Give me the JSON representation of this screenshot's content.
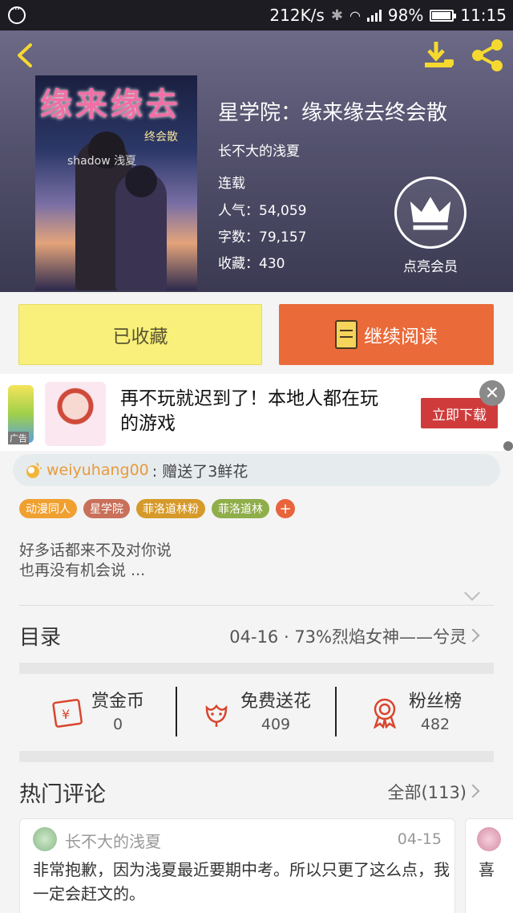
{
  "status_bar": {
    "speed": "212K/s",
    "battery": "98%",
    "time": "11:15"
  },
  "book": {
    "cover_title": "缘来缘去",
    "cover_small": "来",
    "cover_sub": "终会散",
    "cover_mark": "shadow 浅夏",
    "title": "星学院：缘来缘去终会散",
    "author": "长不大的浅夏",
    "status": "连载",
    "popularity": "人气：54,059",
    "word_count": "字数：79,157",
    "favorites": "收藏：430"
  },
  "vip": {
    "label": "点亮会员"
  },
  "actions": {
    "collected_label": "已收藏",
    "read_label": "继续阅读"
  },
  "ad": {
    "badge": "广告",
    "text": "再不玩就迟到了！本地人都在玩的游戏",
    "download_label": "立即下载",
    "close": "✕"
  },
  "gift": {
    "user": "weiyuhang00",
    "text": ": 赠送了3鲜花"
  },
  "tags": [
    {
      "label": "动漫同人",
      "color": "#f0a030"
    },
    {
      "label": "星学院",
      "color": "#c8705a"
    },
    {
      "label": "菲洛道林粉",
      "color": "#d69a2a"
    },
    {
      "label": "菲洛道林",
      "color": "#8fae4a"
    }
  ],
  "tag_add": "+",
  "description": {
    "line1": "好多话都来不及对你说",
    "line2": "也再没有机会说 ..."
  },
  "catalog": {
    "title": "目录",
    "latest": "04-16 · 73%烈焰女神——兮灵"
  },
  "stats": {
    "coins_label": "赏金币",
    "coins_value": "0",
    "flowers_label": "免费送花",
    "flowers_value": "409",
    "fans_label": "粉丝榜",
    "fans_value": "482"
  },
  "comments": {
    "title": "热门评论",
    "all_label": "全部(113)",
    "items": [
      {
        "user": "长不大的浅夏",
        "date": "04-15",
        "text": "非常抱歉，因为浅夏最近要期中考。所以只更了这么点，我一定会赶文的。"
      },
      {
        "text": "喜"
      }
    ]
  },
  "colors": {
    "accent_orange": "#ea6a3a",
    "collected_yellow": "#f8f07a",
    "header_purple": "#55536f",
    "ad_red": "#cf3b3b"
  }
}
